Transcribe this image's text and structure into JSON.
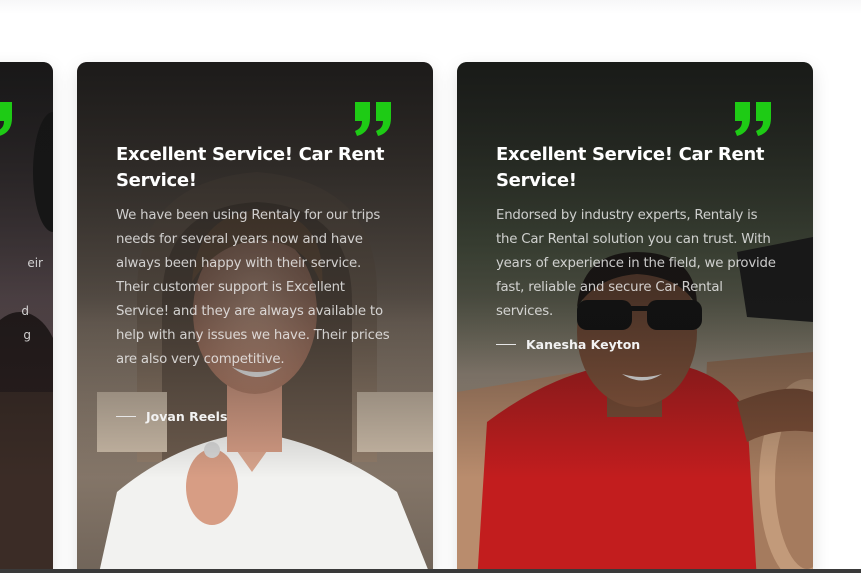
{
  "testimonials": [
    {
      "title": "Excellent Service! Car Rent Service!",
      "text": "We have been using Rentaly for our trips needs for several years now and have always been happy with their service. Their customer support is Excellent Service! and they are always available to help with any issues we have. Their prices are also very competitive.",
      "author": "Jovan Reels"
    },
    {
      "title": "Excellent Service! Car Rent Service!",
      "text": "Endorsed by industry experts, Rentaly is the Car Rental solution you can trust. With years of experience in the field, we provide fast, reliable and secure Car Rental services.",
      "author": "Kanesha Keyton"
    }
  ],
  "partial_card": {
    "snippets": [
      "eir",
      "d",
      "g"
    ]
  },
  "colors": {
    "accent": "#1ecb15",
    "card_dark": "#1b1b1b"
  },
  "icons": {
    "quote": "quote-icon"
  }
}
